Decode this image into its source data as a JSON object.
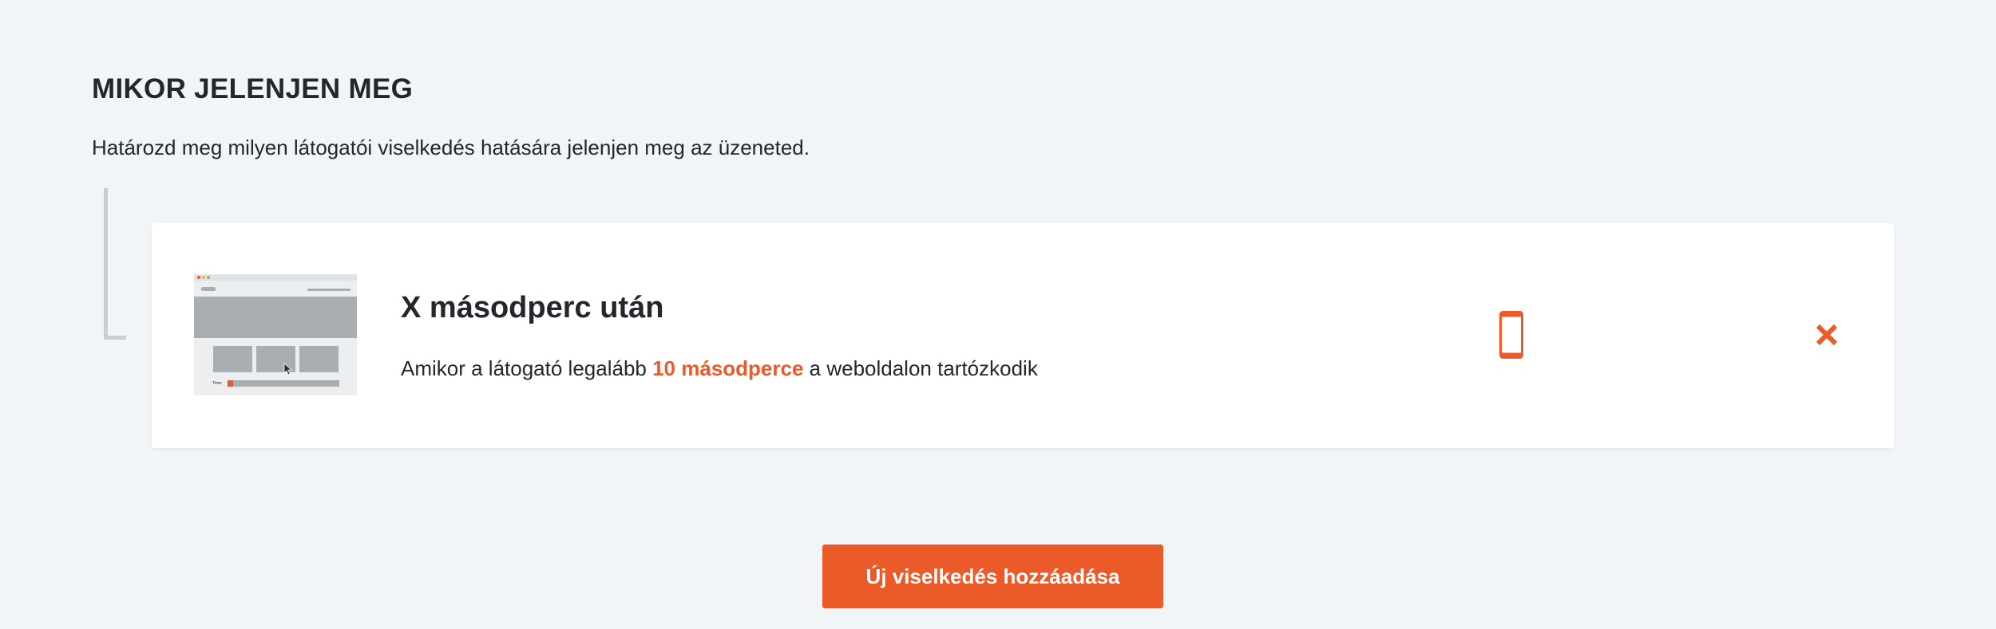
{
  "section": {
    "title": "MIKOR JELENJEN MEG",
    "description": "Határozd meg milyen látogatói viselkedés hatására jelenjen meg az üzeneted."
  },
  "behavior_card": {
    "title": "X másodperc után",
    "text_before": "Amikor a látogató legalább ",
    "text_highlight": "10 másodperce",
    "text_after": " a weboldalon tartózkodik",
    "thumbnail_label": "Time:",
    "device_icon": "mobile-phone-icon",
    "remove_icon": "close-icon"
  },
  "add_button_label": "Új viselkedés hozzáadása",
  "colors": {
    "accent": "#eb5a29",
    "background": "#f2f5f8",
    "card": "#ffffff",
    "text": "#23262b"
  }
}
